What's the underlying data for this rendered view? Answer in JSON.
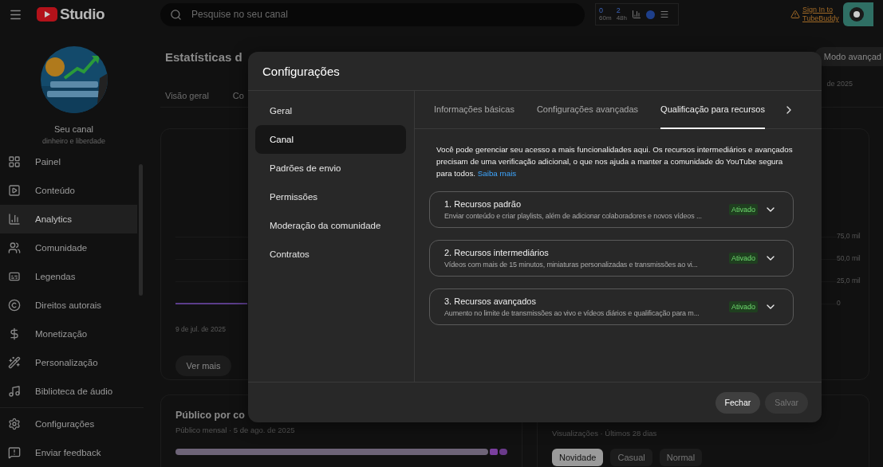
{
  "topbar": {
    "logo_text": "Studio",
    "search": {
      "placeholder": "Pesquise no seu canal"
    },
    "widget": {
      "counts": [
        {
          "value": "0",
          "label": "60m"
        },
        {
          "value": "2",
          "label": "48h"
        }
      ]
    },
    "tubebuddy_link": "Sign In to TubeBuddy"
  },
  "sidebar": {
    "channel_title": "Seu canal",
    "channel_name": "dinheiro e liberdade",
    "items": [
      {
        "label": "Painel",
        "selected": false
      },
      {
        "label": "Conteúdo",
        "selected": false
      },
      {
        "label": "Analytics",
        "selected": true
      },
      {
        "label": "Comunidade",
        "selected": false
      },
      {
        "label": "Legendas",
        "selected": false
      },
      {
        "label": "Direitos autorais",
        "selected": false
      },
      {
        "label": "Monetização",
        "selected": false
      },
      {
        "label": "Personalização",
        "selected": false
      },
      {
        "label": "Biblioteca de áudio",
        "selected": false
      }
    ],
    "footer_items": [
      {
        "label": "Configurações"
      },
      {
        "label": "Enviar feedback"
      }
    ]
  },
  "main": {
    "title": "Estatísticas d",
    "mode_button": "Modo avançad",
    "date_range": "de 2025",
    "tabs": [
      "Visão geral",
      "Co"
    ],
    "chart_card": {
      "axis_labels": [
        "75,0 mil",
        "50,0 mil",
        "25,0 mil",
        "0"
      ],
      "date": "9 de jul. de 2025",
      "button": "Ver mais"
    },
    "audience_card": {
      "title": "Público por co",
      "subtitle": "Público mensal · 5 de ago. de 2025"
    },
    "views_card": {
      "subtitle": "Visualizações · Últimos 28 dias",
      "chips": [
        {
          "label": "Novidade",
          "selected": true
        },
        {
          "label": "Casual",
          "selected": false
        },
        {
          "label": "Normal",
          "selected": false
        }
      ]
    }
  },
  "dialog": {
    "title": "Configurações",
    "nav": [
      {
        "label": "Geral",
        "selected": false
      },
      {
        "label": "Canal",
        "selected": true
      },
      {
        "label": "Padrões de envio",
        "selected": false
      },
      {
        "label": "Permissões",
        "selected": false
      },
      {
        "label": "Moderação da comunidade",
        "selected": false
      },
      {
        "label": "Contratos",
        "selected": false
      }
    ],
    "tabs": [
      {
        "label": "Informações básicas",
        "selected": false
      },
      {
        "label": "Configurações avançadas",
        "selected": false
      },
      {
        "label": "Qualificação para recursos",
        "selected": true
      }
    ],
    "intro": "Você pode gerenciar seu acesso a mais funcionalidades aqui. Os recursos intermediários e avançados precisam de uma verificação adicional, o que nos ajuda a manter a comunidade do YouTube segura para todos.",
    "intro_link": "Saiba mais",
    "features": [
      {
        "title": "1. Recursos padrão",
        "description": "Enviar conteúdo e criar playlists, além de adicionar colaboradores e novos vídeos ...",
        "status": "Ativado",
        "expanded": false
      },
      {
        "title": "2. Recursos intermediários",
        "description": "Vídeos com mais de 15 minutos, miniaturas personalizadas e transmissões ao vi...",
        "status": "Ativado",
        "expanded": false
      },
      {
        "title": "3. Recursos avançados",
        "description": "Aumento no limite de transmissões ao vivo e vídeos diários e qualificação para m...",
        "status": "Ativado",
        "expanded": false
      }
    ],
    "buttons": [
      {
        "label": "Fechar",
        "disabled": false
      },
      {
        "label": "Salvar",
        "disabled": true
      }
    ]
  }
}
